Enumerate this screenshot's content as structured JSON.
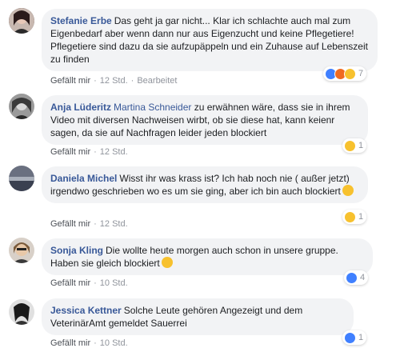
{
  "comments": [
    {
      "author": "Stefanie Erbe",
      "mention": "",
      "text": "Das geht ja gar nicht... Klar ich schlachte auch mal zum Eigenbedarf aber wenn dann nur aus Eigenzucht und keine Pflegetiere! Pflegetiere sind dazu da sie aufzupäppeln und ein Zuhause auf Lebenszeit zu finden",
      "like": "Gefällt mir",
      "time": "12 Std.",
      "edited": "Bearbeitet",
      "reactions": [
        "like-icon",
        "angry-icon",
        "sad-icon"
      ],
      "reaction_count": "7"
    },
    {
      "author": "Anja Lüderitz",
      "mention": "Martina Schneider",
      "text": "zu erwähnen wäre, dass sie in ihrem Video mit diversen Nachweisen wirbt, ob sie diese hat, kann keienr sagen, da sie auf Nachfragen leider jeden blockiert",
      "like": "Gefällt mir",
      "time": "12 Std.",
      "reactions": [
        "sad-icon"
      ],
      "reaction_count": "1"
    },
    {
      "author": "Daniela Michel",
      "mention": "",
      "text": "Wisst ihr was krass ist? Ich hab noch nie ( außer jetzt) irgendwo geschrieben wo es um sie ging, aber ich bin auch blockiert",
      "emoji": "thinking-emoji",
      "like": "Gefällt mir",
      "time": "12 Std.",
      "reactions": [
        "sad-icon"
      ],
      "reaction_count": "1"
    },
    {
      "author": "Sonja Kling",
      "mention": "",
      "text": "Die wollte heute morgen auch schon in unsere gruppe. Haben sie gleich blockiert",
      "emoji": "rolling-eyes-emoji",
      "like": "Gefällt mir",
      "time": "10 Std.",
      "reactions": [
        "like-icon"
      ],
      "reaction_count": "4"
    },
    {
      "author": "Jessica Kettner",
      "mention": "",
      "text": "Solche Leute gehören Angezeigt und dem VeterinärAmt gemeldet Sauerrei",
      "like": "Gefällt mir",
      "time": "10 Std.",
      "reactions": [
        "like-icon"
      ],
      "reaction_count": "1"
    }
  ]
}
